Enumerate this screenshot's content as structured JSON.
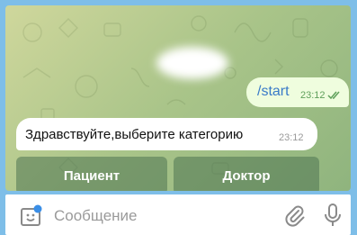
{
  "chat": {
    "outgoing_message": {
      "text": "/start",
      "time": "23:12",
      "status_icon": "double-check-icon"
    },
    "incoming_message": {
      "text": "Здравствуйте,выберите категорию",
      "time": "23:12"
    },
    "keyboard": {
      "buttons": [
        {
          "label": "Пациент"
        },
        {
          "label": "Доктор"
        }
      ]
    }
  },
  "composer": {
    "placeholder": "Сообщение",
    "left_icon": "emoji-sticker-icon",
    "attach_icon": "paperclip-icon",
    "mic_icon": "microphone-icon"
  },
  "colors": {
    "frame": "#7ebee8",
    "outgoing_bubble": "#effdde",
    "outgoing_time": "#5fa05b",
    "link": "#3a7bc8",
    "accent": "#3a8ee6"
  }
}
